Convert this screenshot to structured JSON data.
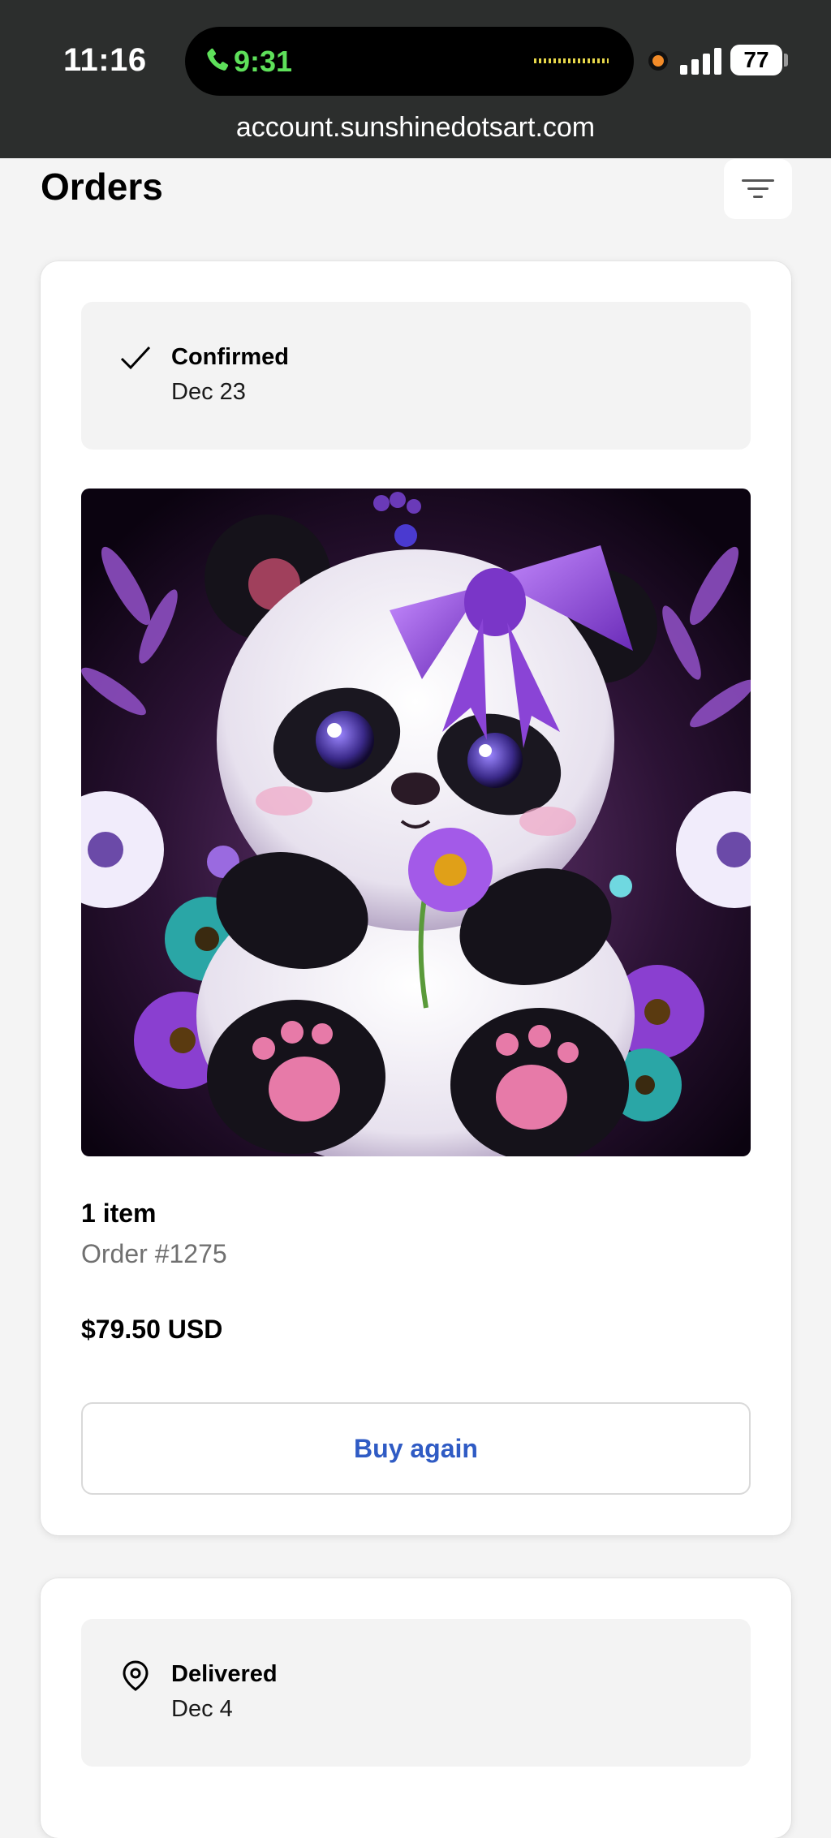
{
  "status_bar": {
    "time": "11:16",
    "call_time": "9:31",
    "battery": "77"
  },
  "browser": {
    "url": "account.sunshinedotsart.com"
  },
  "header": {
    "title": "Orders",
    "filter_icon": "filter-icon"
  },
  "orders": [
    {
      "status": "Confirmed",
      "status_icon": "checkmark-icon",
      "date": "Dec 23",
      "image_description": "product-image",
      "item_count": "1 item",
      "order_number": "Order #1275",
      "price": "$79.50 USD",
      "action_label": "Buy again"
    },
    {
      "status": "Delivered",
      "status_icon": "location-pin-icon",
      "date": "Dec 4"
    }
  ],
  "colors": {
    "status_bar_bg": "#2c2e2d",
    "call_green": "#5ee05a",
    "link_blue": "#2f5bc4",
    "page_bg": "#f4f4f4"
  }
}
